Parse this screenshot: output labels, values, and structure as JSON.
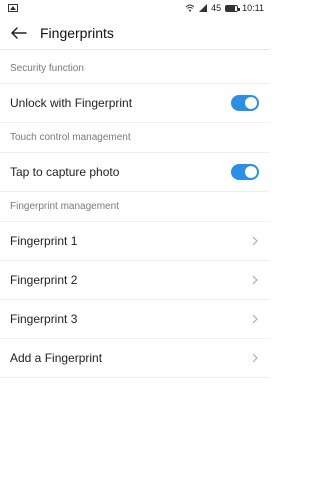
{
  "status_bar": {
    "network_label": "45",
    "time": "10:11",
    "battery_level": 0.82,
    "icons": [
      "gallery-icon",
      "wifi-icon",
      "signal-icon",
      "battery-icon"
    ]
  },
  "header": {
    "title": "Fingerprints",
    "back_icon": "back-arrow-icon"
  },
  "sections": {
    "security": {
      "title": "Security function",
      "unlock_label": "Unlock with Fingerprint",
      "unlock_enabled": true
    },
    "touch": {
      "title": "Touch control management",
      "capture_label": "Tap to capture photo",
      "capture_enabled": true
    },
    "fingerprints": {
      "title": "Fingerprint management",
      "items": [
        {
          "label": "Fingerprint 1"
        },
        {
          "label": "Fingerprint 2"
        },
        {
          "label": "Fingerprint 3"
        },
        {
          "label": "Add a Fingerprint"
        }
      ]
    }
  },
  "colors": {
    "accent": "#2c8fe6",
    "section_text": "#7a7a7a",
    "divider": "#efefef"
  }
}
